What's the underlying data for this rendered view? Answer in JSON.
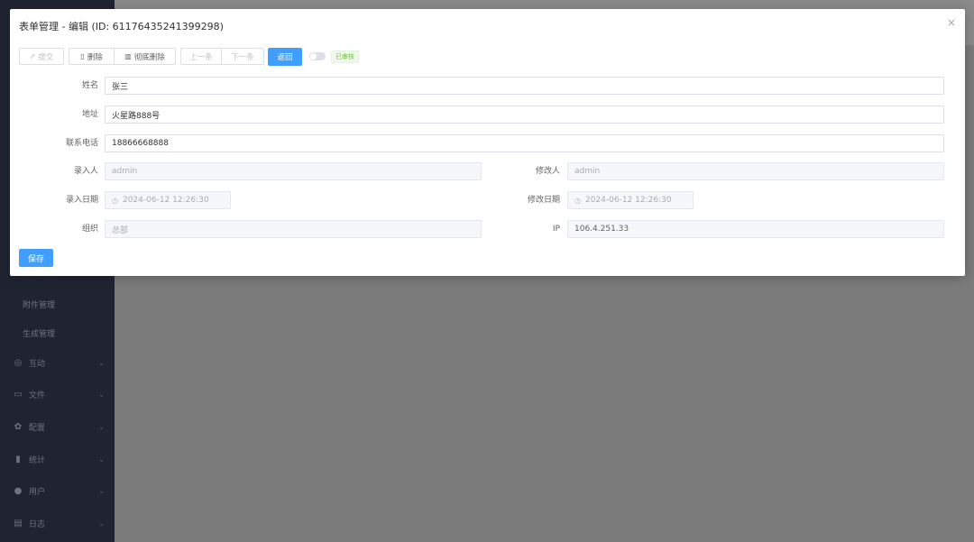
{
  "sidebar": {
    "sub_items": [
      {
        "label": "附件管理"
      },
      {
        "label": "生成管理"
      }
    ],
    "items": [
      {
        "icon": "chat-icon",
        "glyph": "◎",
        "label": "互动"
      },
      {
        "icon": "folder-icon",
        "glyph": "▭",
        "label": "文件"
      },
      {
        "icon": "gear-icon",
        "glyph": "✿",
        "label": "配置"
      },
      {
        "icon": "bar-chart-icon",
        "glyph": "▮",
        "label": "统计"
      },
      {
        "icon": "user-icon",
        "glyph": "●",
        "label": "用户"
      },
      {
        "icon": "log-icon",
        "glyph": "▤",
        "label": "日志"
      }
    ]
  },
  "dialog": {
    "title": "表单管理 - 编辑 (ID: 611764352413992 98)",
    "close_glyph": "×"
  },
  "toolbar": {
    "submit_label": "提交",
    "delete_label": "删除",
    "purge_label": "彻底删除",
    "prev_label": "上一条",
    "next_label": "下一条",
    "back_label": "返回",
    "status_tag": "已审核"
  },
  "form": {
    "name_label": "姓名",
    "name_value": "张三",
    "address_label": "地址",
    "address_value": "火星路888号",
    "phone_label": "联系电话",
    "phone_value": "18866668888",
    "creator_label": "录入人",
    "creator_value": "admin",
    "modifier_label": "修改人",
    "modifier_value": "admin",
    "create_date_label": "录入日期",
    "create_date_value": "2024-06-12 12:26:30",
    "modify_date_label": "修改日期",
    "modify_date_value": "2024-06-12 12:26:30",
    "org_label": "组织",
    "org_placeholder": "总部",
    "ip_label": "IP",
    "ip_value": "106.4.251.33"
  },
  "save_label": "保存",
  "colors": {
    "primary": "#409eff",
    "success": "#67c23a",
    "sidebar_bg": "#1f2430"
  }
}
